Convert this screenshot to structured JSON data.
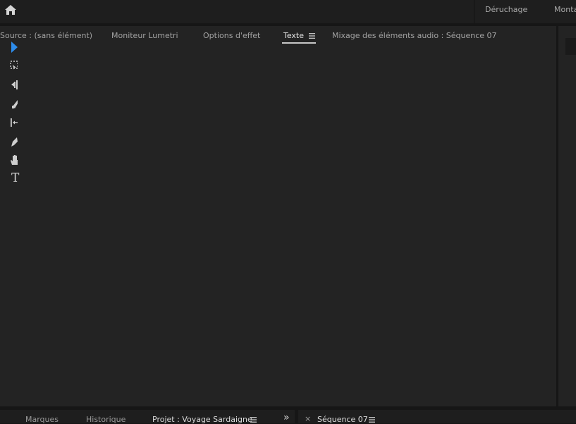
{
  "workspace_bar": {
    "home_icon": "home-icon",
    "tabs": [
      {
        "label": "Déruchage"
      },
      {
        "label": "Monta"
      }
    ]
  },
  "main_panel": {
    "tabs": [
      {
        "label": "Source : (sans élément)"
      },
      {
        "label": "Moniteur Lumetri"
      },
      {
        "label": "Options d'effet"
      },
      {
        "label": "Texte",
        "active": true
      },
      {
        "label": "Mixage des éléments audio : Séquence 07"
      }
    ],
    "menu_icon": "hamburger-menu-icon"
  },
  "tools": [
    {
      "icon": "selection-arrow-icon",
      "active": true
    },
    {
      "icon": "track-select-icon"
    },
    {
      "icon": "ripple-edit-icon"
    },
    {
      "icon": "razor-icon"
    },
    {
      "icon": "slip-icon"
    },
    {
      "icon": "pen-icon"
    },
    {
      "icon": "hand-icon"
    },
    {
      "icon": "type-tool-icon"
    }
  ],
  "tools_type_glyph": "T",
  "bottom_left": {
    "tabs": [
      {
        "label": "Marques"
      },
      {
        "label": "Historique"
      },
      {
        "label": "Projet : Voyage Sardaigne",
        "active": true
      }
    ],
    "overflow_glyph": "»"
  },
  "bottom_right": {
    "close_glyph": "×",
    "tabs": [
      {
        "label": "Séquence 07",
        "active": true
      }
    ]
  },
  "colors": {
    "panel_bg": "#232323",
    "frame_bg": "#161616",
    "accent_blue": "#2d8ceb"
  }
}
